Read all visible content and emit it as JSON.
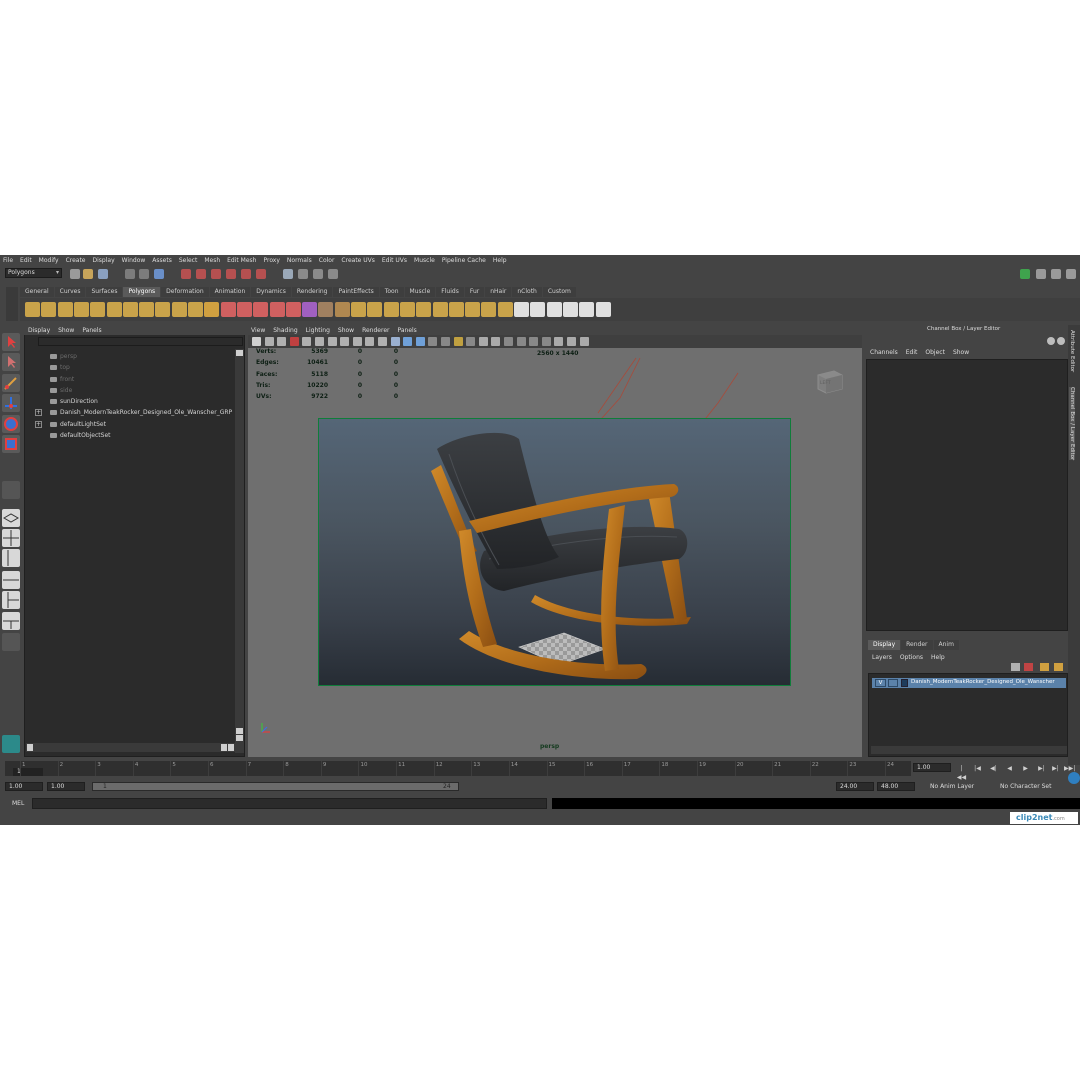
{
  "menubar": [
    "File",
    "Edit",
    "Modify",
    "Create",
    "Display",
    "Window",
    "Assets",
    "Select",
    "Mesh",
    "Edit Mesh",
    "Proxy",
    "Normals",
    "Color",
    "Create UVs",
    "Edit UVs",
    "Muscle",
    "Pipeline Cache",
    "Help"
  ],
  "statusline": {
    "mode": "Polygons"
  },
  "shelf": {
    "tabs": [
      "General",
      "Curves",
      "Surfaces",
      "Polygons",
      "Deformation",
      "Animation",
      "Dynamics",
      "Rendering",
      "PaintEffects",
      "Toon",
      "Muscle",
      "Fluids",
      "Fur",
      "nHair",
      "nCloth",
      "Custom"
    ],
    "active": "Polygons"
  },
  "outliner": {
    "menu": [
      "Display",
      "Show",
      "Panels"
    ],
    "items": [
      {
        "label": "persp",
        "dim": true,
        "expand": false
      },
      {
        "label": "top",
        "dim": true,
        "expand": false
      },
      {
        "label": "front",
        "dim": true,
        "expand": false
      },
      {
        "label": "side",
        "dim": true,
        "expand": false
      },
      {
        "label": "sunDirection",
        "dim": false,
        "expand": false
      },
      {
        "label": "Danish_ModernTeakRocker_Designed_Ole_Wanscher_GRP",
        "dim": false,
        "expand": true
      },
      {
        "label": "defaultLightSet",
        "dim": false,
        "expand": true
      },
      {
        "label": "defaultObjectSet",
        "dim": false,
        "expand": false
      }
    ]
  },
  "viewport": {
    "menu": [
      "View",
      "Shading",
      "Lighting",
      "Show",
      "Renderer",
      "Panels"
    ],
    "hud": [
      {
        "key": "Verts:",
        "v1": "5369",
        "v2": "0",
        "v3": "0"
      },
      {
        "key": "Edges:",
        "v1": "10461",
        "v2": "0",
        "v3": "0"
      },
      {
        "key": "Faces:",
        "v1": "5118",
        "v2": "0",
        "v3": "0"
      },
      {
        "key": "Tris:",
        "v1": "10220",
        "v2": "0",
        "v3": "0"
      },
      {
        "key": "UVs:",
        "v1": "9722",
        "v2": "0",
        "v3": "0"
      }
    ],
    "resolution": "2560 x 1440",
    "camera": "persp",
    "viewcube_label": "LEFT"
  },
  "channelbox": {
    "title": "Channel Box / Layer Editor",
    "menu": [
      "Channels",
      "Edit",
      "Object",
      "Show"
    ],
    "side_tabs": [
      "Attribute Editor",
      "Channel Box / Layer Editor"
    ]
  },
  "layers": {
    "tabs": [
      "Display",
      "Render",
      "Anim"
    ],
    "active": "Display",
    "menu": [
      "Layers",
      "Options",
      "Help"
    ],
    "rows": [
      {
        "visible": "V",
        "name": "Danish_ModernTeakRocker_Designed_Ole_Wanscher"
      }
    ]
  },
  "timeline": {
    "ticks": [
      "1",
      "2",
      "3",
      "4",
      "5",
      "6",
      "7",
      "8",
      "9",
      "10",
      "11",
      "12",
      "13",
      "14",
      "15",
      "16",
      "17",
      "18",
      "19",
      "20",
      "21",
      "22",
      "23",
      "24"
    ],
    "current_frame": "1",
    "current_time": "1.00",
    "start": "1.00",
    "start_inner": "1.00",
    "range_start": "1",
    "range_end": "24",
    "end_inner": "24.00",
    "end": "48.00",
    "anim_layer": "No Anim Layer",
    "char_set": "No Character Set"
  },
  "commandline": {
    "label": "MEL"
  },
  "watermark": {
    "brand": "clip2net",
    "suffix": ".com"
  },
  "colors": {
    "accent": "#5b82aa",
    "gate_border": "#0f7d3a",
    "teak": "#b8741c",
    "cushion": "#2e3033"
  }
}
